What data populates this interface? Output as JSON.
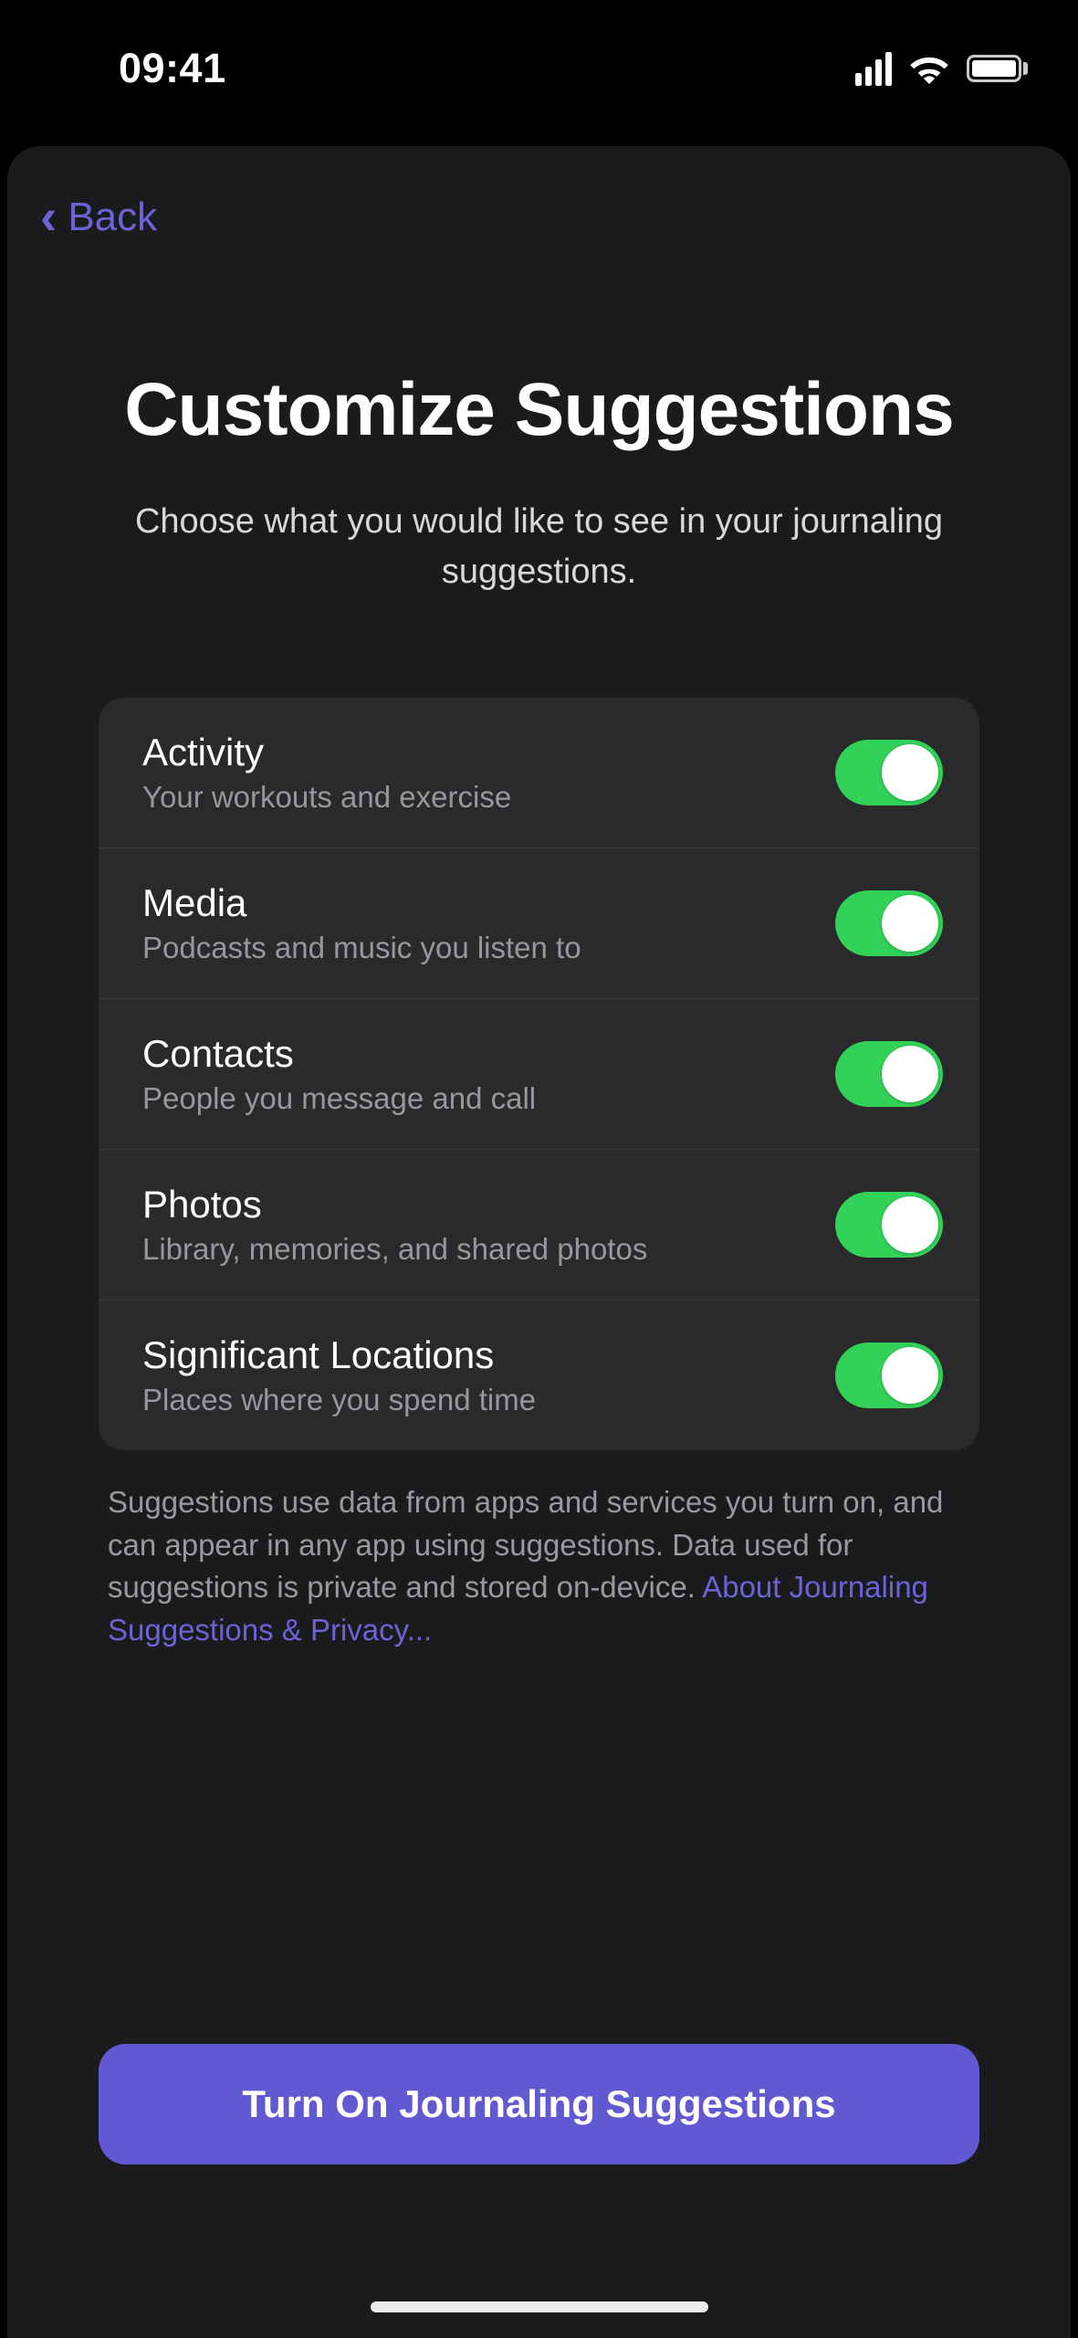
{
  "status": {
    "time": "09:41"
  },
  "nav": {
    "back_label": "Back"
  },
  "header": {
    "title": "Customize Suggestions",
    "subtitle": "Choose what you would like to see in your journaling suggestions."
  },
  "options": [
    {
      "title": "Activity",
      "subtitle": "Your workouts and exercise",
      "on": true
    },
    {
      "title": "Media",
      "subtitle": "Podcasts and music you listen to",
      "on": true
    },
    {
      "title": "Contacts",
      "subtitle": "People you message and call",
      "on": true
    },
    {
      "title": "Photos",
      "subtitle": "Library, memories, and shared photos",
      "on": true
    },
    {
      "title": "Significant Locations",
      "subtitle": "Places where you spend time",
      "on": true
    }
  ],
  "footer": {
    "text": "Suggestions use data from apps and services you turn on, and can appear in any app using suggestions. Data used for suggestions is private and stored on-device. ",
    "link": "About Journaling Suggestions & Privacy..."
  },
  "primary_button": "Turn On Journaling Suggestions"
}
